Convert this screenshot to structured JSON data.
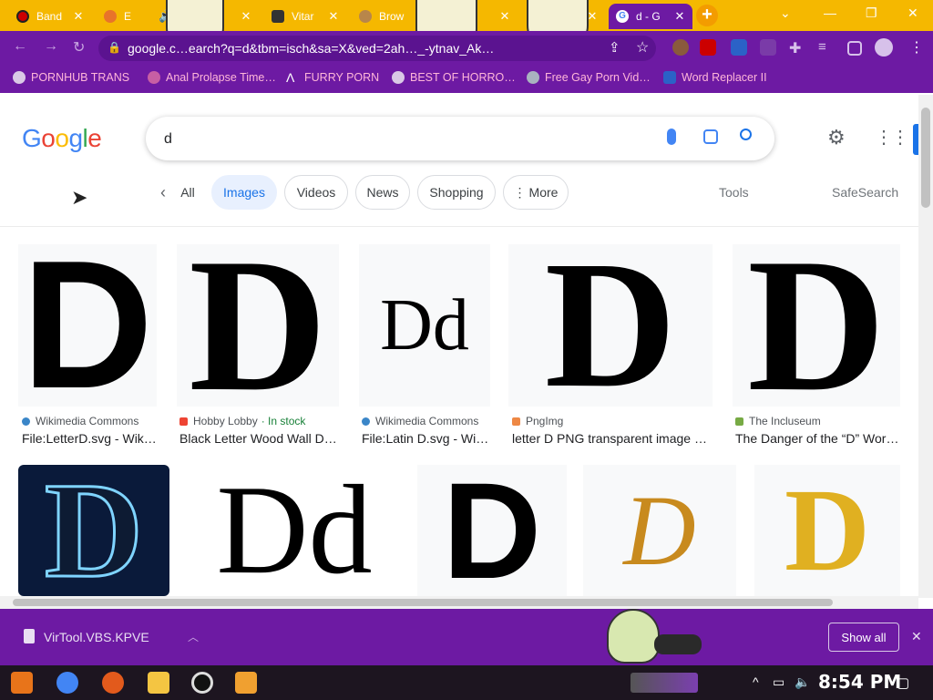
{
  "tabs": [
    {
      "label": "Band",
      "active": false
    },
    {
      "label": "E",
      "active": false
    },
    {
      "label": "",
      "active": false
    },
    {
      "label": "Vitar",
      "active": false
    },
    {
      "label": "Brow",
      "active": false
    },
    {
      "label": "",
      "active": false
    },
    {
      "label": "",
      "active": false
    },
    {
      "label": "d - G",
      "active": true
    }
  ],
  "omnibox": {
    "url": "google.c…earch?q=d&tbm=isch&sa=X&ved=2ah…_-ytnav_Ak…"
  },
  "bookmarks": [
    "PORNHUB TRANS",
    "Anal Prolapse Time…",
    "FURRY PORN",
    "BEST OF HORRO…",
    "Free Gay Porn Vid…",
    "Word Replacer II"
  ],
  "google": {
    "logo": "Google",
    "query": "d",
    "chips": [
      "All",
      "Images",
      "Videos",
      "News",
      "Shopping",
      "More"
    ],
    "tools": "Tools",
    "safesearch": "SafeSearch"
  },
  "results_row1": [
    {
      "source": "Wikimedia Commons",
      "extra": "",
      "caption": "File:LetterD.svg - Wik…",
      "glyph": "D"
    },
    {
      "source": "Hobby Lobby",
      "extra": "· In stock",
      "caption": "Black Letter Wood Wall D…",
      "glyph": "D"
    },
    {
      "source": "Wikimedia Commons",
      "extra": "",
      "caption": "File:Latin D.svg - Wi…",
      "glyph": "Dd"
    },
    {
      "source": "PngImg",
      "extra": "",
      "caption": "letter D PNG transparent image …",
      "glyph": "D"
    },
    {
      "source": "The Incluseum",
      "extra": "",
      "caption": "The Danger of the “D” Wor…",
      "glyph": "D"
    }
  ],
  "results_row2": [
    {
      "glyph": "D"
    },
    {
      "glyph": "Dd"
    },
    {
      "glyph": "D"
    },
    {
      "glyph": "D"
    },
    {
      "glyph": "D"
    }
  ],
  "download": {
    "filename": "VirTool.VBS.KPVE",
    "show_all": "Show all"
  },
  "taskbar": {
    "clock": "8:54 PM"
  },
  "colors": {
    "tabbar": "#f5b800",
    "chrome_purple": "#6d1aa3",
    "google_blue": "#4285f4"
  }
}
